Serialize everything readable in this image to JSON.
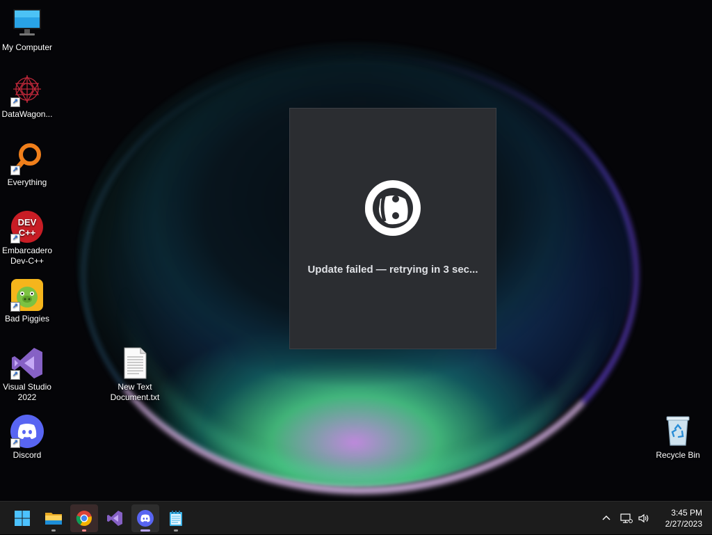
{
  "desktop": {
    "icons": [
      {
        "label": "My Computer",
        "icon": "monitor-icon"
      },
      {
        "label": "DataWagon...",
        "icon": "datawagon-icon"
      },
      {
        "label": "Everything",
        "icon": "everything-search-icon"
      },
      {
        "label": "Embarcadero Dev-C++",
        "icon": "devcpp-icon",
        "badge": "DEV C++"
      },
      {
        "label": "Bad Piggies",
        "icon": "bad-piggies-icon"
      },
      {
        "label": "Visual Studio 2022",
        "icon": "visual-studio-icon"
      },
      {
        "label": "Discord",
        "icon": "discord-icon"
      },
      {
        "label": "New Text Document.txt",
        "icon": "text-file-icon"
      },
      {
        "label": "Recycle Bin",
        "icon": "recycle-bin-icon"
      }
    ]
  },
  "dialog": {
    "message": "Update failed — retrying in 3 sec...",
    "icon": "discord-logo-icon",
    "background": "#2b2d31"
  },
  "taskbar": {
    "apps": [
      {
        "name": "Start",
        "icon": "windows-start-icon"
      },
      {
        "name": "File Explorer",
        "icon": "folder-icon"
      },
      {
        "name": "Google Chrome",
        "icon": "chrome-icon"
      },
      {
        "name": "Visual Studio",
        "icon": "visual-studio-icon"
      },
      {
        "name": "Discord",
        "icon": "discord-icon"
      },
      {
        "name": "Notepad",
        "icon": "notepad-icon"
      }
    ],
    "tray": {
      "icons": [
        "chevron-up-icon",
        "network-icon",
        "volume-icon"
      ]
    },
    "clock": {
      "time": "3:45 PM",
      "date": "2/27/2023"
    }
  },
  "colors": {
    "accent": "#5865f2",
    "taskbar": "#1c1c1c"
  }
}
